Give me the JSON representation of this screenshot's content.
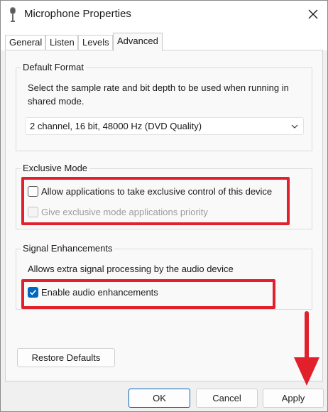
{
  "window": {
    "title": "Microphone Properties",
    "title_icon": "microphone-icon",
    "close_icon": "close-icon"
  },
  "tabs": [
    {
      "label": "General",
      "active": false
    },
    {
      "label": "Listen",
      "active": false
    },
    {
      "label": "Levels",
      "active": false
    },
    {
      "label": "Advanced",
      "active": true
    }
  ],
  "default_format": {
    "label": "Default Format",
    "description": "Select the sample rate and bit depth to be used when running in shared mode.",
    "selected_value": "2 channel, 16 bit, 48000 Hz (DVD Quality)"
  },
  "exclusive_mode": {
    "label": "Exclusive Mode",
    "allow_exclusive": {
      "label": "Allow applications to take exclusive control of this device",
      "checked": false,
      "enabled": true
    },
    "exclusive_priority": {
      "label": "Give exclusive mode applications priority",
      "checked": false,
      "enabled": false
    }
  },
  "signal_enhancements": {
    "label": "Signal Enhancements",
    "description": "Allows extra signal processing by the audio device",
    "enable_enhancements": {
      "label": "Enable audio enhancements",
      "checked": true,
      "enabled": true
    }
  },
  "buttons": {
    "restore_defaults": "Restore Defaults",
    "ok": "OK",
    "cancel": "Cancel",
    "apply": "Apply"
  },
  "colors": {
    "accent": "#0067c0",
    "annotation": "#e2202c"
  }
}
